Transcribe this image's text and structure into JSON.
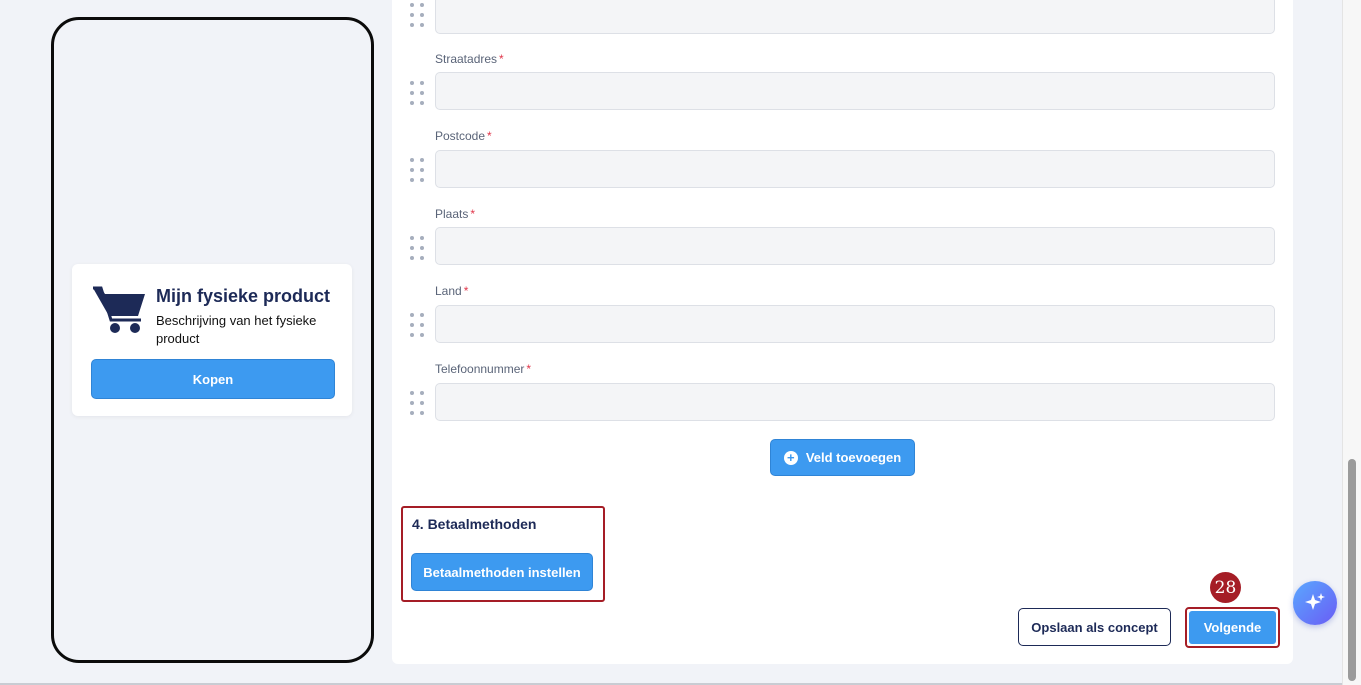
{
  "preview": {
    "product_title": "Mijn fysieke product",
    "product_description": "Beschrijving van het fysieke product",
    "buy_label": "Kopen",
    "cart_icon": "shopping-cart-icon"
  },
  "form": {
    "required_marker": "*",
    "fields": [
      {
        "label": "Straatadres",
        "value": ""
      },
      {
        "label": "Postcode",
        "value": ""
      },
      {
        "label": "Plaats",
        "value": ""
      },
      {
        "label": "Land",
        "value": ""
      },
      {
        "label": "Telefoonnummer",
        "value": ""
      }
    ],
    "add_field_label": "Veld toevoegen"
  },
  "payment": {
    "section_title": "4. Betaalmethoden",
    "setup_label": "Betaalmethoden instellen"
  },
  "footer": {
    "draft_label": "Opslaan als concept",
    "next_label": "Volgende",
    "step_badge": "28"
  },
  "colors": {
    "accent": "#3d9af0",
    "highlight": "#a51d26",
    "navy": "#1d2a57"
  }
}
